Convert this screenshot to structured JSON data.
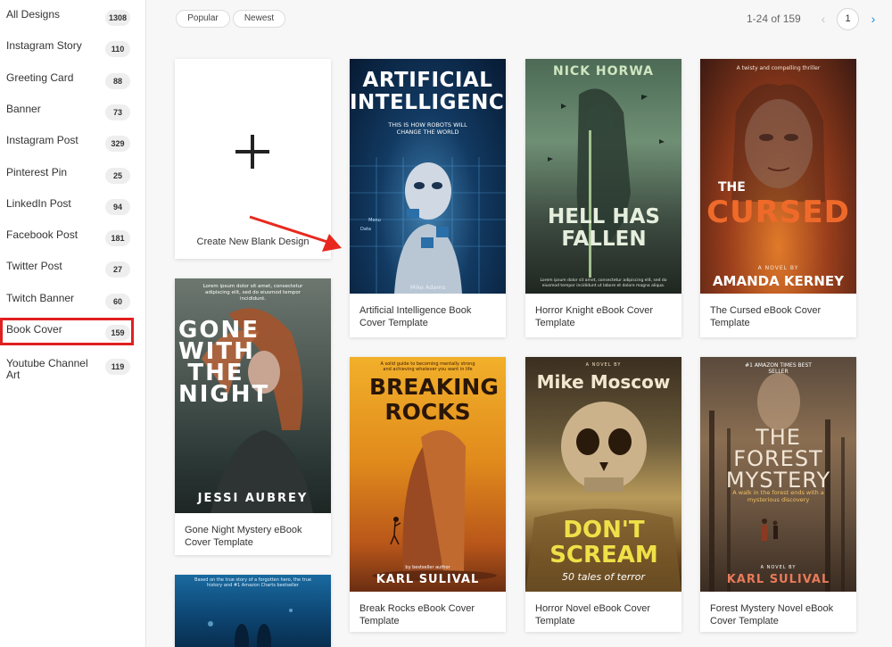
{
  "sidebar": {
    "items": [
      {
        "label": "All Designs",
        "count": "1308"
      },
      {
        "label": "Instagram Story",
        "count": "110"
      },
      {
        "label": "Greeting Card",
        "count": "88"
      },
      {
        "label": "Banner",
        "count": "73"
      },
      {
        "label": "Instagram Post",
        "count": "329"
      },
      {
        "label": "Pinterest Pin",
        "count": "25"
      },
      {
        "label": "LinkedIn Post",
        "count": "94"
      },
      {
        "label": "Facebook Post",
        "count": "181"
      },
      {
        "label": "Twitter Post",
        "count": "27"
      },
      {
        "label": "Twitch Banner",
        "count": "60"
      },
      {
        "label": "Book Cover",
        "count": "159"
      },
      {
        "label": "Youtube Channel Art",
        "count": "119"
      }
    ]
  },
  "filters": {
    "popular": "Popular",
    "newest": "Newest"
  },
  "pager": {
    "range": "1-24 of 159",
    "page": "1",
    "prev_icon": "‹",
    "next_icon": "›"
  },
  "blank": {
    "label": "Create New Blank Design"
  },
  "cards": [
    {
      "title": "Artificial Intelligence Book Cover Template",
      "cover": {
        "title": "ARTIFICIAL INTELLIGENCE",
        "subtitle": "THIS IS HOW ROBOTS WILL CHANGE THE WORLD",
        "author": "Mike Adams",
        "hud": [
          "Menu",
          "Data"
        ]
      }
    },
    {
      "title": "Horror Knight eBook Cover Template",
      "cover": {
        "author": "NICK HORWA",
        "title": "HELL HAS FALLEN",
        "blurb": "Lorem ipsum dolor sit amet, consectetur adipiscing elit, sed do eiusmod tempor incididunt ut labore et dolore magna aliqua."
      }
    },
    {
      "title": "The Cursed eBook Cover Template",
      "cover": {
        "tagline": "A twisty and compelling thriller",
        "pre": "THE",
        "title": "CURSED",
        "byline": "A NOVEL BY",
        "author": "AMANDA KERNEY"
      }
    },
    {
      "title": "Gone Night Mystery eBook Cover Template",
      "cover": {
        "blurb": "Lorem ipsum dolor sit amet, consectetur adipiscing elit, sed do eiusmod tempor incididunt.",
        "title": "GONE WITH THE NIGHT",
        "author": "JESSI AUBREY"
      }
    },
    {
      "title": "Break Rocks eBook Cover Template",
      "cover": {
        "tagline": "A solid guide to becoming mentally strong and achieving whatever you want in life",
        "title": "BREAKING ROCKS",
        "byline": "by bestseller author",
        "author": "KARL SULIVAL"
      }
    },
    {
      "title": "Horror Novel eBook Cover Template",
      "cover": {
        "byline": "A NOVEL BY",
        "author": "Mike Moscow",
        "title": "DON'T SCREAM",
        "subtitle": "50 tales of terror"
      }
    },
    {
      "title": "Forest Mystery Novel eBook Cover Template",
      "cover": {
        "badge": "#1 AMAZON TIMES BEST SELLER",
        "title": "THE FOREST MYSTERY",
        "tagline": "A walk in the forest ends with a mysterious discovery",
        "byline": "A NOVEL BY",
        "author": "KARL SULIVAL"
      }
    },
    {
      "cover": {
        "blurb": "Based on the true story of a forgotten hero, the true history and #1 Amazon Charts bestseller"
      }
    }
  ]
}
